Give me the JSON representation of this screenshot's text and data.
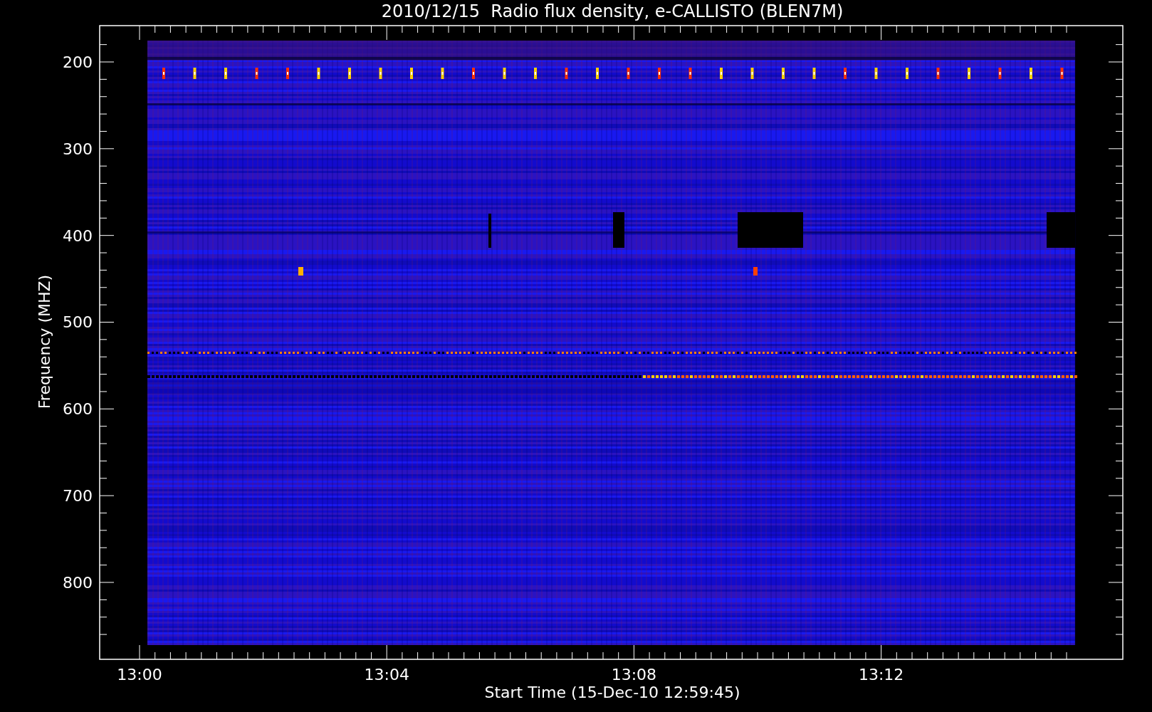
{
  "chart": {
    "title": "2010/12/15  Radio flux density, e-CALLISTO (BLEN7M)",
    "ylabel": "Frequency (MHZ)",
    "xlabel": "Start Time (15-Dec-10 12:59:45)",
    "yticks": [
      "200",
      "300",
      "400",
      "500",
      "600",
      "700",
      "800"
    ],
    "xticks": [
      "13:00",
      "13:04",
      "13:08",
      "13:12"
    ]
  }
}
